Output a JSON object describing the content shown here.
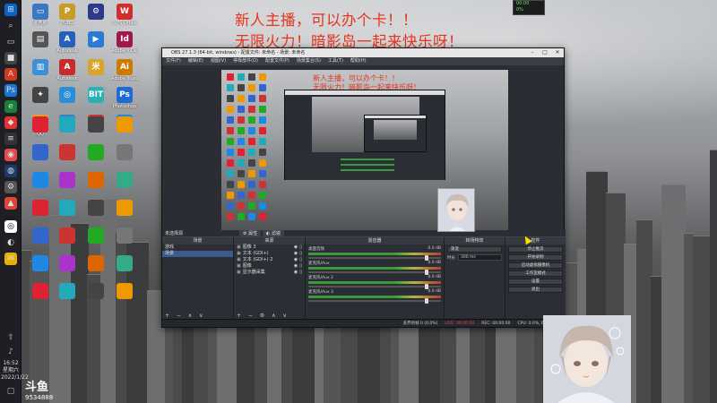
{
  "overlay": {
    "line1": "新人主播，可以办个卡！！",
    "line2": "无限火力！暗影岛一起来快乐呀！",
    "nested_line1": "新人主播，可以办个卡！！",
    "nested_line2": "无限火力！暗影岛一起来快乐呀！"
  },
  "desktop_icons": [
    {
      "label": "此电脑",
      "color": "#3a78c2",
      "glyph": "▭"
    },
    {
      "label": "PUBG",
      "color": "#c89b2a",
      "glyph": "P"
    },
    {
      "label": "",
      "color": "#2d3a8a",
      "glyph": "⚙"
    },
    {
      "label": "WPS Office",
      "color": "#d0302d",
      "glyph": "W"
    },
    {
      "label": "",
      "color": "#555",
      "glyph": "▤"
    },
    {
      "label": "Autodesk",
      "color": "#2760b8",
      "glyph": "A"
    },
    {
      "label": "",
      "color": "#2a7bd6",
      "glyph": "▶"
    },
    {
      "label": "Adobe InDesign",
      "color": "#a0174b",
      "glyph": "Id"
    },
    {
      "label": "",
      "color": "#3f8fd8",
      "glyph": "▥"
    },
    {
      "label": "Autodesk",
      "color": "#c82b2b",
      "glyph": "A"
    },
    {
      "label": "",
      "color": "#d8a42b",
      "glyph": "米"
    },
    {
      "label": "Adobe Illustrator",
      "color": "#cc7a00",
      "glyph": "Ai"
    },
    {
      "label": "",
      "color": "#444",
      "glyph": "✦"
    },
    {
      "label": "",
      "color": "#2a8fd8",
      "glyph": "◎"
    },
    {
      "label": "",
      "color": "#29b1b5",
      "glyph": "BIT"
    },
    {
      "label": "Photoshop",
      "color": "#1c6bd2",
      "glyph": "Ps"
    },
    {
      "label": "QQ",
      "color": "#e0a020",
      "glyph": "◔"
    },
    {
      "label": "",
      "color": "#3b7bd2",
      "glyph": "▦"
    },
    {
      "label": "",
      "color": "#c33",
      "glyph": "✿"
    },
    {
      "label": "",
      "color": "#1e88e5",
      "glyph": "K"
    }
  ],
  "desktop_left_col": [
    "",
    "",
    "",
    "",
    "",
    "",
    "",
    "",
    "",
    "",
    ""
  ],
  "taskbar": {
    "time": "16:52",
    "date": "2022/1/22",
    "day": "星期六"
  },
  "tray": {
    "l1": "00:00",
    "l2": "0%"
  },
  "obs": {
    "title": "OBS 27.1.3 (64-bit, windows) - 配置文件: 未命名 - 场景: 未命名",
    "menu": [
      "文件(F)",
      "编辑(E)",
      "视图(V)",
      "停靠部件(D)",
      "配置文件(P)",
      "场景集合(S)",
      "工具(T)",
      "帮助(H)"
    ],
    "scene_bar": "未选择源",
    "tab_props": "属性",
    "tab_filters": "滤镜",
    "panels": {
      "scenes": "场景",
      "sources": "来源",
      "mixer": "混音器",
      "transitions": "转场特效",
      "controls": "控件"
    },
    "scenes": [
      "游戏",
      "场景"
    ],
    "sources": [
      "图像 3",
      "文本 (GDI+)",
      "文本 (GDI+) 2",
      "图像",
      "显示器采集"
    ],
    "mixer": [
      {
        "name": "桌面音频",
        "level": "0.0 dB"
      },
      {
        "name": "麦克风/Aux",
        "level": "0.0 dB"
      },
      {
        "name": "麦克风/Aux 2",
        "level": "0.0 dB"
      },
      {
        "name": "麦克风/Aux 3",
        "level": "0.0 dB"
      }
    ],
    "transition": "渐变",
    "duration_label": "时长",
    "duration": "300 ms",
    "controls": [
      "停止推流",
      "开始录制",
      "启动虚拟摄像机",
      "工作室模式",
      "设置",
      "退出"
    ],
    "status": {
      "dropped": "丢弃的帧 0 (0.0%)",
      "live": "LIVE: 00:00:00",
      "rec": "REC: 00:00:00",
      "cpu": "CPU: 0.0%, 60.00 fps"
    }
  },
  "douyu": {
    "logo": "斗鱼",
    "room": "9534888"
  }
}
